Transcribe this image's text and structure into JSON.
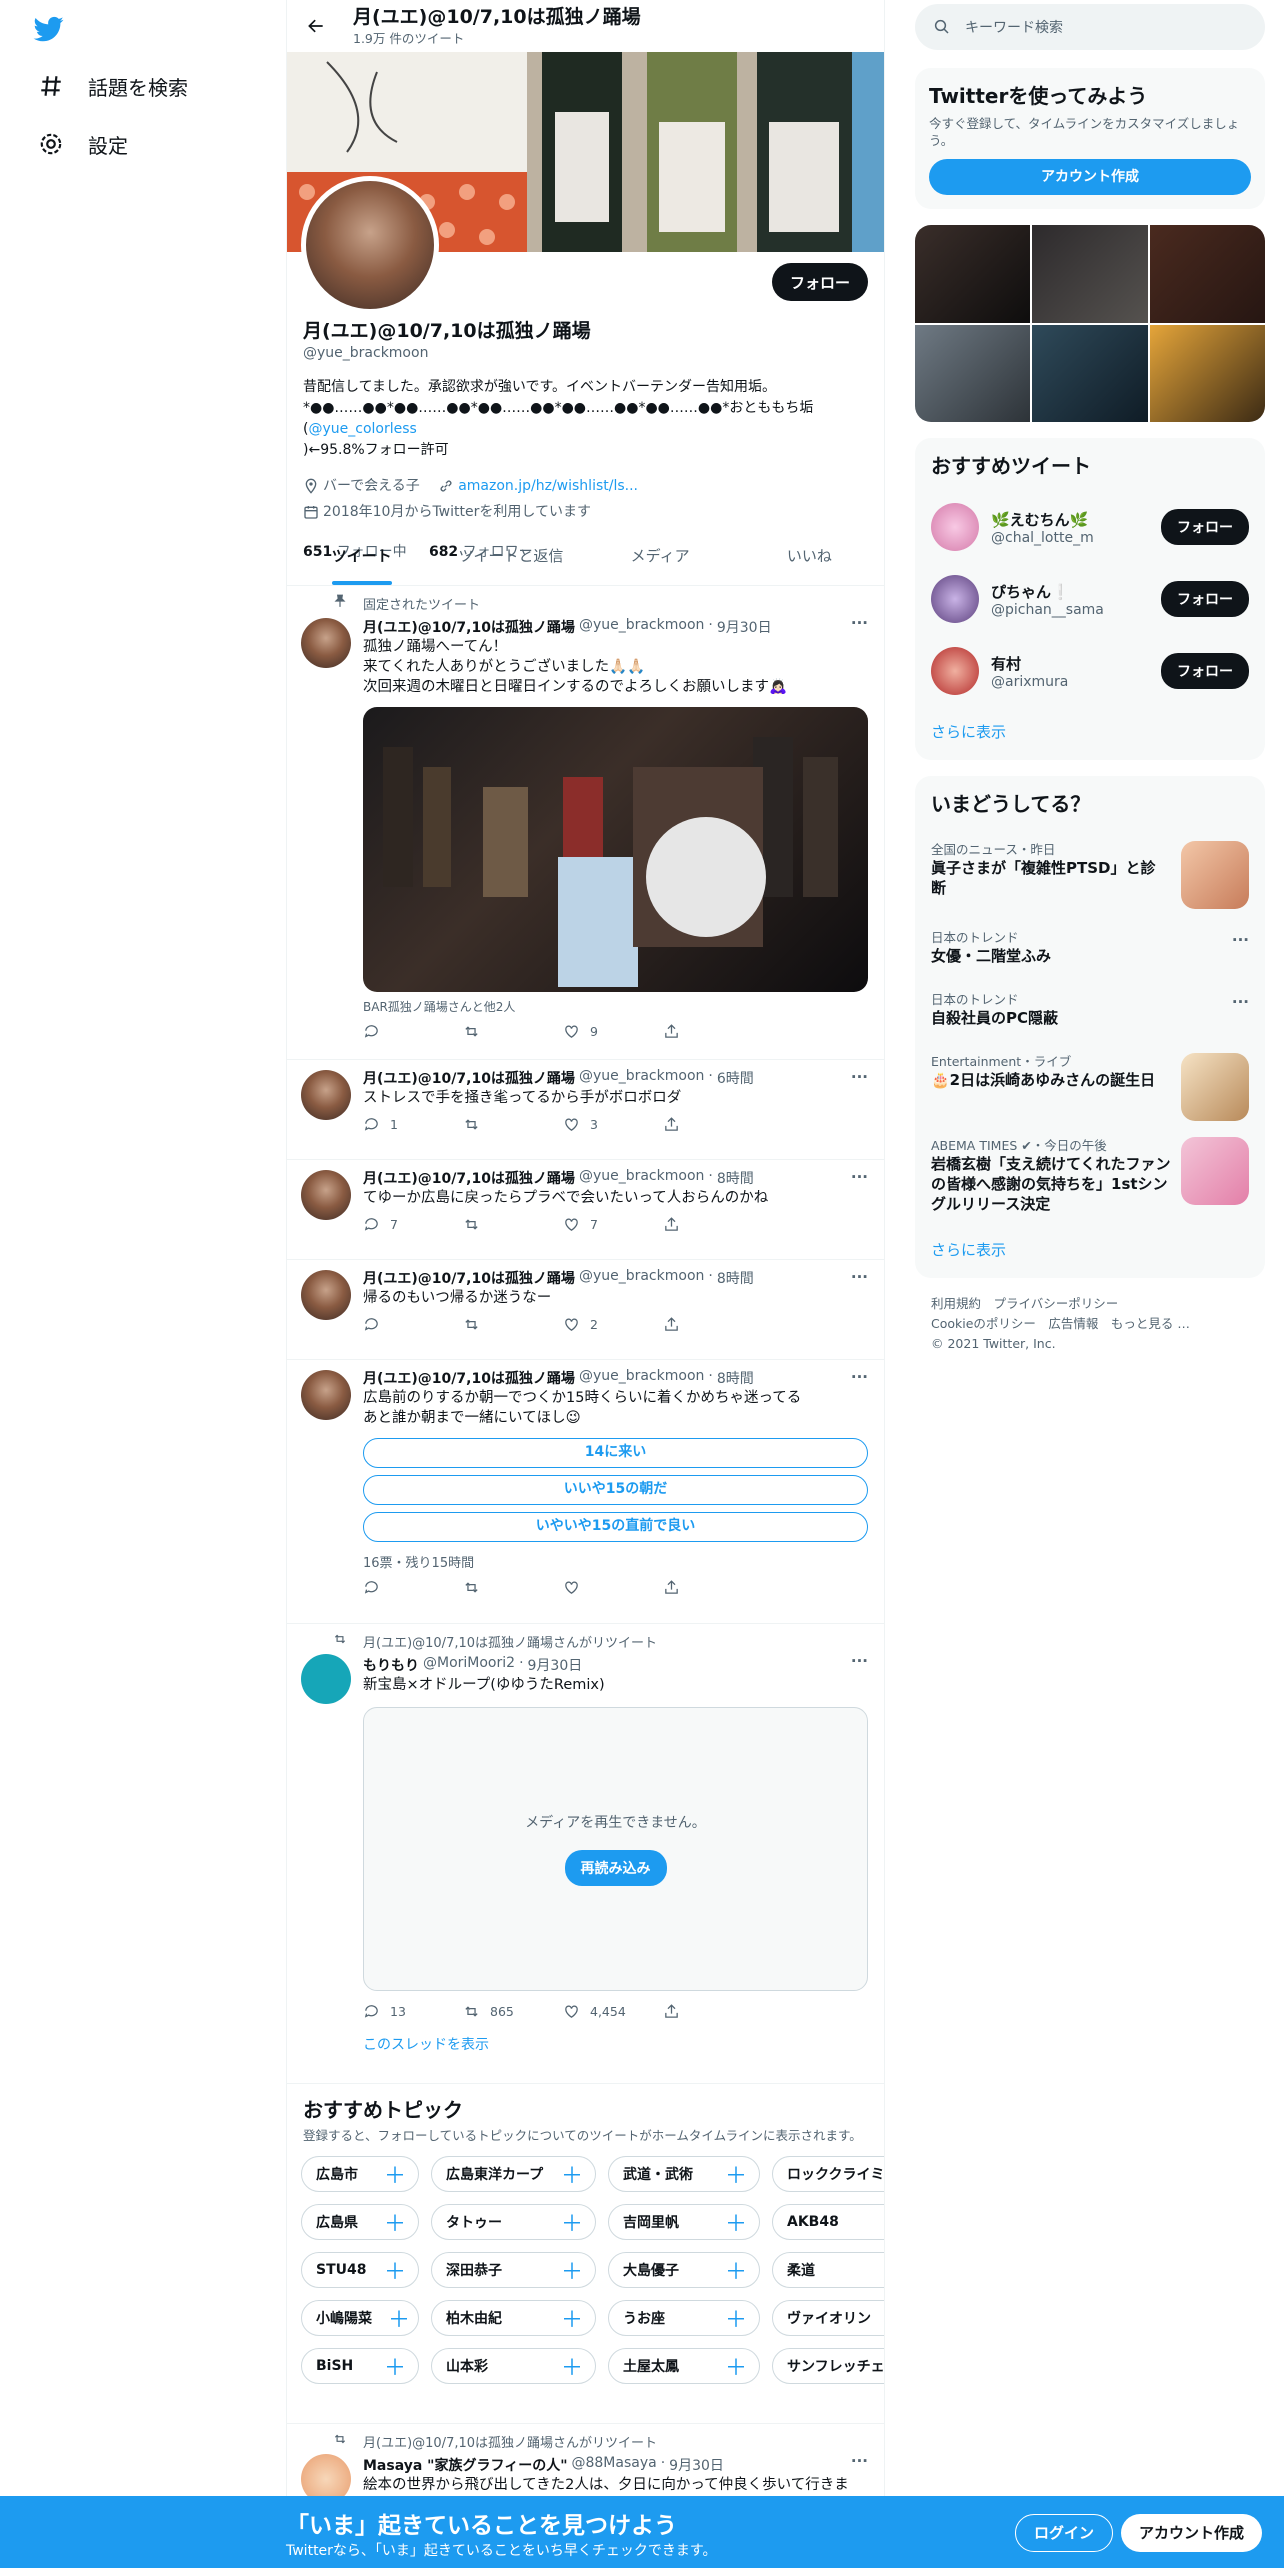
{
  "nav": {
    "explore": "話題を検索",
    "settings": "設定"
  },
  "header": {
    "title": "月(ユエ)@10/7,10は孤独ノ踊場",
    "subtitle": "1.9万 件のツイート"
  },
  "profile": {
    "name": "月(ユエ)@10/7,10は孤独ノ踊場",
    "handle": "@yue_brackmoon",
    "follow": "フォロー",
    "bio1": "昔配信してました。承認欲求が強いです。イベントバーテンダー告知用垢。",
    "bio2a": "*●●……●●*●●……●●*●●……●●*●●……●●*●●……●●*おとももち垢(",
    "bio2link": "@yue_colorless",
    "bio3": ")←95.8%フォロー許可",
    "location": "バーで会える子",
    "url": "amazon.jp/hz/wishlist/ls...",
    "joined": "2018年10月からTwitterを利用しています",
    "following_num": "651",
    "following_label": "フォロー中",
    "followers_num": "682",
    "followers_label": "フォロワー"
  },
  "tabs": [
    "ツイート",
    "ツイートと返信",
    "メディア",
    "いいね"
  ],
  "tweets": [
    {
      "ctx": "固定されたツイート",
      "name": "月(ユエ)@10/7,10は孤独ノ踊場",
      "handle": "@yue_brackmoon",
      "time": "9月30日",
      "l1": "孤独ノ踊場へーてん！",
      "l2": "来てくれた人ありがとうございました🙏🏻🙏🏻",
      "l3": "次回来週の木曜日と日曜日インするのでよろしくお願いします🙇🏻‍♀️",
      "caption": "BAR孤独ノ踊場さんと他2人",
      "reply": "",
      "rt": "",
      "like": "9"
    },
    {
      "name": "月(ユエ)@10/7,10は孤独ノ踊場",
      "handle": "@yue_brackmoon",
      "time": "6時間",
      "l1": "ストレスで手を掻き毟ってるから手がボロボロダ",
      "reply": "1",
      "rt": "",
      "like": "3"
    },
    {
      "name": "月(ユエ)@10/7,10は孤独ノ踊場",
      "handle": "@yue_brackmoon",
      "time": "8時間",
      "l1": "てゆーか広島に戻ったらプラベで会いたいって人おらんのかね",
      "reply": "7",
      "rt": "",
      "like": "7"
    },
    {
      "name": "月(ユエ)@10/7,10は孤独ノ踊場",
      "handle": "@yue_brackmoon",
      "time": "8時間",
      "l1": "帰るのもいつ帰るか迷うなー",
      "reply": "",
      "rt": "",
      "like": "2"
    },
    {
      "name": "月(ユエ)@10/7,10は孤独ノ踊場",
      "handle": "@yue_brackmoon",
      "time": "8時間",
      "l1": "広島前のりするか朝一でつくか15時くらいに着くかめちゃ迷ってる",
      "l2": "あと誰か朝まで一緒にいてほし😉",
      "poll": [
        "14に来い",
        "いいや15の朝だ",
        "いやいや15の直前で良い"
      ],
      "pollmeta": "16票・残り15時間"
    },
    {
      "ctx": "月(ユエ)@10/7,10は孤独ノ踊場さんがリツイート",
      "name": "もりもり",
      "handle": "@MoriMoori2",
      "time": "9月30日",
      "l1": "新宝島×オドループ(ゆゆうたRemix)",
      "vidmsg": "メディアを再生できません。",
      "vidbtn": "再読み込み",
      "reply": "13",
      "rt": "865",
      "like": "4,454",
      "thread": "このスレッドを表示"
    },
    {
      "ctx": "月(ユエ)@10/7,10は孤独ノ踊場さんがリツイート",
      "name": "Masaya \"家族グラフィーの人\"",
      "handle": "@88Masaya",
      "time": "9月30日",
      "l1": "絵本の世界から飛び出してきた2人は、夕日に向かって仲良く歩いて行きま"
    }
  ],
  "topics": {
    "title": "おすすめトピック",
    "sub": "登録すると、フォローしているトピックについてのツイートがホームタイムラインに表示されます。",
    "rows": [
      [
        "広島市",
        "広島東洋カープ",
        "武道・武術",
        "ロッククライミング"
      ],
      [
        "広島県",
        "タトゥー",
        "吉岡里帆",
        "AKB48"
      ],
      [
        "STU48",
        "深田恭子",
        "大島優子",
        "柔道"
      ],
      [
        "小嶋陽菜",
        "柏木由紀",
        "うお座",
        "ヴァイオリン"
      ],
      [
        "BiSH",
        "山本彩",
        "土屋太鳳",
        "サンフレッチェ広島"
      ]
    ]
  },
  "right": {
    "search": "キーワード検索",
    "signup_title": "Twitterを使ってみよう",
    "signup_text": "今すぐ登録して、タイムラインをカスタマイズしましょう。",
    "signup_btn": "アカウント作成",
    "who_title": "おすすめツイート",
    "who": [
      {
        "name": "🌿えむちん🌿",
        "handle": "@chal_lotte_m",
        "btn": "フォロー"
      },
      {
        "name": "ぴちゃん❕",
        "handle": "@pichan__sama",
        "btn": "フォロー"
      },
      {
        "name": "有村",
        "handle": "@arixmura",
        "btn": "フォロー"
      }
    ],
    "more": "さらに表示",
    "trends_title": "いまどうしてる？",
    "trends": [
      {
        "c": "全国のニュース・昨日",
        "n": "眞子さまが「複雑性PTSD」と診断"
      },
      {
        "c": "日本のトレンド",
        "n": "女優・二階堂ふみ"
      },
      {
        "c": "日本のトレンド",
        "n": "自殺社員のPC隠蔽"
      },
      {
        "c": "Entertainment・ライブ",
        "n": "🎂2日は浜崎あゆみさんの誕生日"
      },
      {
        "c": "ABEMA TIMES ✔・今日の午後",
        "n": "岩橋玄樹「支え続けてくれたファンの皆様へ感謝の気持ちを」1stシングルリリース決定"
      }
    ],
    "footer1": "利用規約　プライバシーポリシー",
    "footer2": "Cookieのポリシー　広告情報　もっと見る …",
    "footer3": "© 2021 Twitter, Inc."
  },
  "bottom": {
    "title": "「いま」起きていることを見つけよう",
    "sub": "Twitterなら、「いま」起きていることをいち早くチェックできます。",
    "login": "ログイン",
    "signup": "アカウント作成"
  }
}
